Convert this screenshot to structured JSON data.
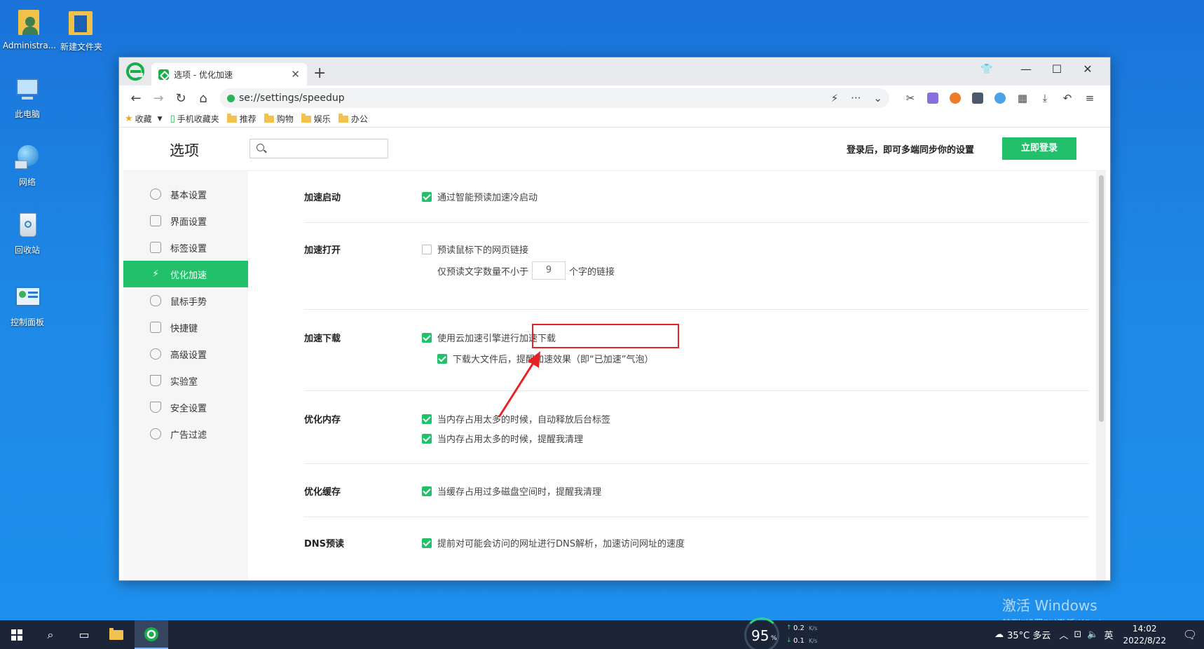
{
  "desktop": {
    "icons": [
      {
        "label": "Administra..."
      },
      {
        "label": "新建文件夹"
      },
      {
        "label": "此电脑"
      },
      {
        "label": "网络"
      },
      {
        "label": "回收站"
      },
      {
        "label": "控制面板"
      }
    ]
  },
  "browser": {
    "tab_title": "选项 - 优化加速",
    "url": "se://settings/speedup",
    "bookmarks": [
      "收藏",
      "手机收藏夹",
      "推荐",
      "购物",
      "娱乐",
      "办公"
    ]
  },
  "settings": {
    "title": "选项",
    "search_placeholder": "",
    "sync_message": "登录后，即可多端同步你的设置",
    "login_button": "立即登录",
    "nav": [
      {
        "label": "基本设置",
        "active": false
      },
      {
        "label": "界面设置",
        "active": false
      },
      {
        "label": "标签设置",
        "active": false
      },
      {
        "label": "优化加速",
        "active": true
      },
      {
        "label": "鼠标手势",
        "active": false
      },
      {
        "label": "快捷键",
        "active": false
      },
      {
        "label": "高级设置",
        "active": false
      },
      {
        "label": "实验室",
        "active": false
      },
      {
        "label": "安全设置",
        "active": false
      },
      {
        "label": "广告过滤",
        "active": false
      }
    ],
    "sections": {
      "startup": {
        "label": "加速启动",
        "opt1": "通过智能预读加速冷启动"
      },
      "open": {
        "label": "加速打开",
        "opt1": "预读鼠标下的网页链接",
        "prefix": "仅预读文字数量不小于",
        "count": "9",
        "suffix": "个字的链接"
      },
      "download": {
        "label": "加速下载",
        "opt1": "使用云加速引擎进行加速下载",
        "opt2": "下载大文件后，提醒加速效果（即“已加速”气泡）"
      },
      "memory": {
        "label": "优化内存",
        "opt1": "当内存占用太多的时候，自动释放后台标签",
        "opt2": "当内存占用太多的时候，提醒我清理"
      },
      "cache": {
        "label": "优化缓存",
        "opt1": "当缓存占用过多磁盘空间时，提醒我清理"
      },
      "dns": {
        "label": "DNS预读",
        "opt1": "提前对可能会访问的网址进行DNS解析，加速访问网址的速度"
      }
    }
  },
  "watermark": {
    "line1": "激活 Windows",
    "line2": "转到“设置”以激活 Windows。"
  },
  "taskbar": {
    "cpu": "95",
    "cpu_unit": "%",
    "net_up": "0.2",
    "net_down": "0.1",
    "net_unit": "K/s",
    "weather": "35°C 多云",
    "lang": "英",
    "time": "14:02",
    "date": "2022/8/22"
  },
  "colors": {
    "accent": "#22c06a",
    "highlight": "#e82222",
    "taskbar": "#1b2537"
  }
}
